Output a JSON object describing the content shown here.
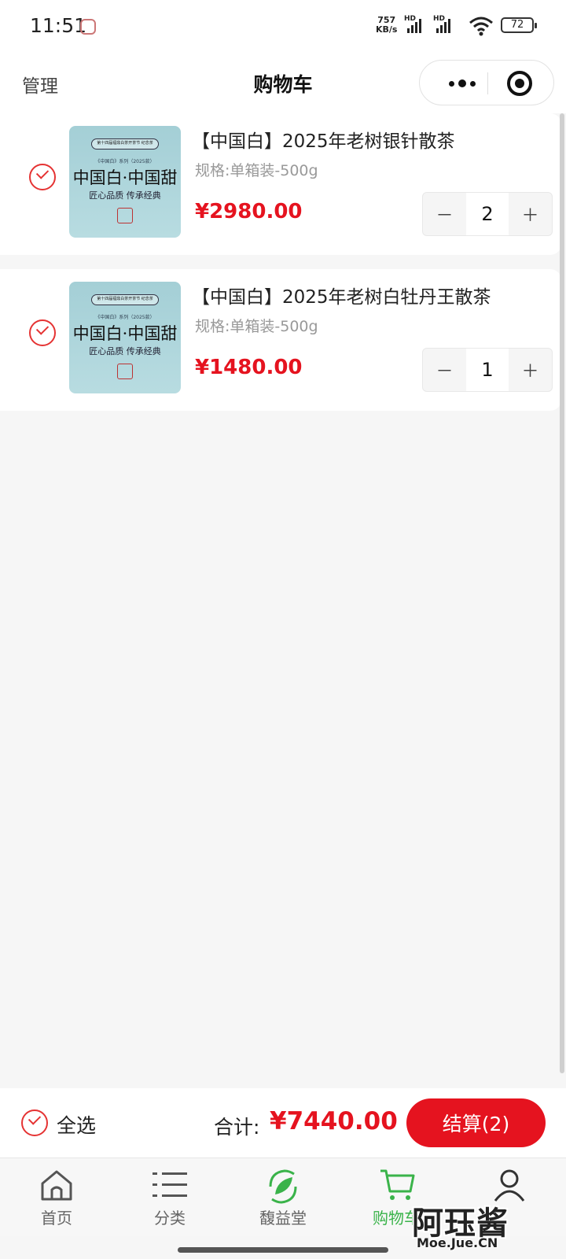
{
  "status_bar": {
    "time": "11:51",
    "net_speed_value": "757",
    "net_speed_unit": "KB/s",
    "signal_1_label": "HD",
    "signal_2_label": "HD",
    "battery": "72"
  },
  "nav": {
    "manage_label": "管理",
    "title": "购物车",
    "more_icon": "more-dots-icon",
    "close_icon": "target-icon"
  },
  "cart": {
    "items": [
      {
        "title": "【中国白】2025年老树银针散茶",
        "spec": "规格:单箱装-500g",
        "price": "¥2980.00",
        "quantity": "2",
        "checked": true,
        "image": {
          "banner": "第十四届福鼎白茶开茶节 纪念茶",
          "series": "《中国白》系列（2025款）",
          "big_text": "中国白·中国甜",
          "slogan": "匠心品质 传承经典"
        }
      },
      {
        "title": "【中国白】2025年老树白牡丹王散茶",
        "spec": "规格:单箱装-500g",
        "price": "¥1480.00",
        "quantity": "1",
        "checked": true,
        "image": {
          "banner": "第十四届福鼎白茶开茶节 纪念茶",
          "series": "《中国白》系列（2025款）",
          "big_text": "中国白·中国甜",
          "slogan": "匠心品质 传承经典"
        }
      }
    ],
    "stepper_minus": "－",
    "stepper_plus": "＋"
  },
  "checkout": {
    "select_all_label": "全选",
    "total_label": "合计:",
    "total_value": "¥7440.00",
    "button_label": "结算(2)"
  },
  "tabs": [
    {
      "label": "首页",
      "icon": "home-icon"
    },
    {
      "label": "分类",
      "icon": "list-icon"
    },
    {
      "label": "馥益堂",
      "icon": "leaf-icon"
    },
    {
      "label": "购物车",
      "icon": "cart-icon",
      "active": true
    },
    {
      "label": "",
      "icon": "user-icon"
    }
  ],
  "watermark": {
    "text": "阿珏酱",
    "url": "Moe.Jue.CN"
  },
  "colors": {
    "accent_red": "#e5131f",
    "check_red": "#e53333",
    "tab_active_green": "#3ab34a",
    "image_teal": "#a4cfd6"
  }
}
